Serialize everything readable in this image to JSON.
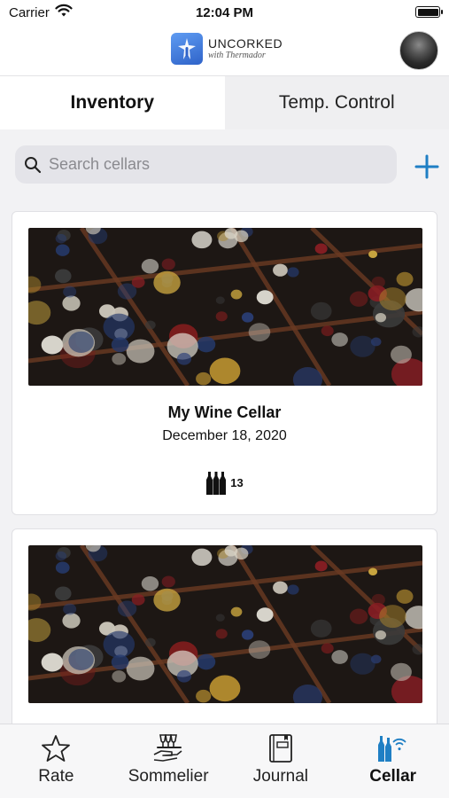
{
  "status_bar": {
    "carrier": "Carrier",
    "time": "12:04 PM"
  },
  "header": {
    "brand": "UNCORKED",
    "brand_sub": "with Thermador",
    "avatar_icon": "user-avatar"
  },
  "tabs": [
    {
      "label": "Inventory",
      "active": true
    },
    {
      "label": "Temp. Control",
      "active": false
    }
  ],
  "search": {
    "placeholder": "Search cellars",
    "value": "",
    "add_icon": "plus-icon"
  },
  "colors": {
    "accent": "#1f7fc4",
    "brand": "#3f7fe0",
    "background": "#f2f2f4"
  },
  "cellars": [
    {
      "name": "My Wine Cellar",
      "date": "December 18, 2020",
      "bottle_count": "13",
      "icon": "wine-bottles-icon"
    },
    {
      "name": "",
      "date": "",
      "bottle_count": "",
      "icon": "wine-bottles-icon"
    }
  ],
  "tab_bar": [
    {
      "label": "Rate",
      "icon": "star-icon",
      "active": false
    },
    {
      "label": "Sommelier",
      "icon": "sommelier-tray-icon",
      "active": false
    },
    {
      "label": "Journal",
      "icon": "journal-icon",
      "active": false
    },
    {
      "label": "Cellar",
      "icon": "cellar-bottles-icon",
      "active": true
    }
  ]
}
